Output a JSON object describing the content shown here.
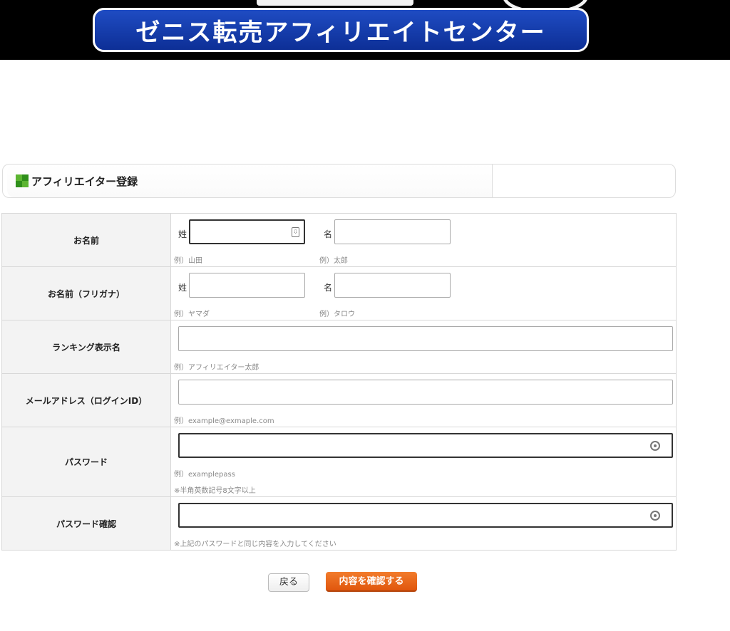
{
  "header": {
    "banner_text": "ゼニス転売アフィリエイトセンター"
  },
  "section": {
    "title": "アフィリエイター登録",
    "icon": "green-grid-icon",
    "icon_colors": [
      "#5cb531",
      "#2f8f1a",
      "#2f8f1a",
      "#5cb531"
    ]
  },
  "form": {
    "name": {
      "label": "お名前",
      "sei_label": "姓",
      "mei_label": "名",
      "sei_example": "例）山田",
      "mei_example": "例）太郎",
      "sei_value": "",
      "mei_value": ""
    },
    "kana": {
      "label": "お名前（フリガナ）",
      "sei_label": "姓",
      "mei_label": "名",
      "sei_example": "例）ヤマダ",
      "mei_example": "例）タロウ",
      "sei_value": "",
      "mei_value": ""
    },
    "ranking": {
      "label": "ランキング表示名",
      "example": "例）アフィリエイター太郎",
      "value": ""
    },
    "email": {
      "label": "メールアドレス（ログインID）",
      "example": "例）example@exmaple.com",
      "value": ""
    },
    "password": {
      "label": "パスワード",
      "example": "例）examplepass",
      "note": "※半角英数記号8文字以上",
      "value": ""
    },
    "password_confirm": {
      "label": "パスワード確認",
      "note": "※上記のパスワードと同じ内容を入力してください",
      "value": ""
    }
  },
  "buttons": {
    "back": "戻る",
    "confirm": "内容を確認する"
  },
  "colors": {
    "banner_blue": "#1f4cc3",
    "confirm_orange": "#e9661b"
  }
}
